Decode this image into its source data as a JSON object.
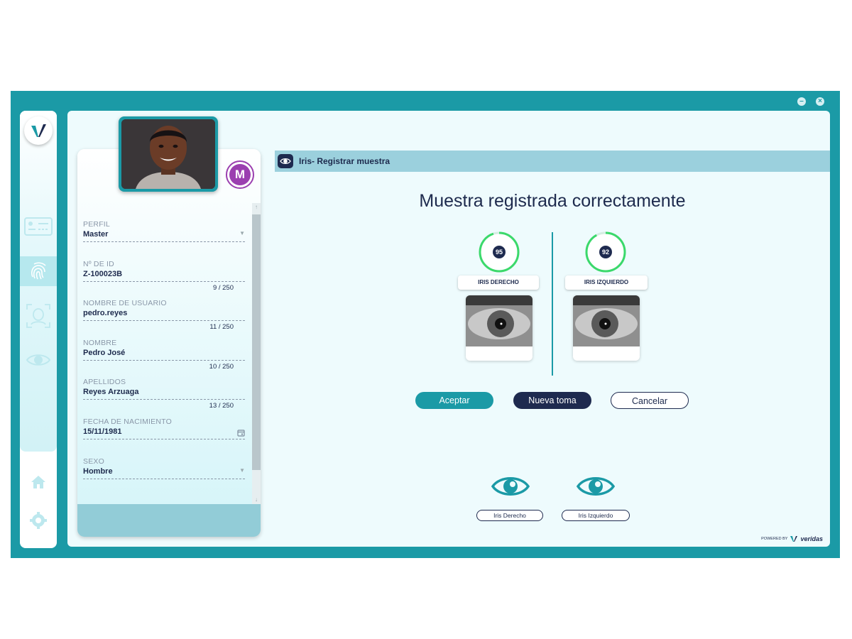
{
  "colors": {
    "primary": "#1b9aa6",
    "navy": "#1e2a4f",
    "badge": "#9b3fb0"
  },
  "sidebar": {
    "items": [
      {
        "name": "id-card-icon"
      },
      {
        "name": "fingerprint-icon",
        "active": true
      },
      {
        "name": "face-scan-icon"
      },
      {
        "name": "eye-icon"
      },
      {
        "name": "home-icon"
      },
      {
        "name": "gear-icon"
      }
    ]
  },
  "user": {
    "badge": "M",
    "fields": [
      {
        "label": "PERFIL",
        "value": "Master",
        "type": "select"
      },
      {
        "label": "Nº DE ID",
        "value": "Z-100023B",
        "count": "9 / 250"
      },
      {
        "label": "NOMBRE DE USUARIO",
        "value": "pedro.reyes",
        "count": "11 / 250"
      },
      {
        "label": "NOMBRE",
        "value": "Pedro José",
        "count": "10 / 250"
      },
      {
        "label": "APELLIDOS",
        "value": "Reyes Arzuaga",
        "count": "13 / 250"
      },
      {
        "label": "FECHA DE NACIMIENTO",
        "value": "15/11/1981",
        "type": "date"
      },
      {
        "label": "SEXO",
        "value": "Hombre",
        "type": "select"
      }
    ]
  },
  "section": {
    "title": "Iris- Registrar muestra"
  },
  "headline": "Muestra registrada correctamente",
  "iris": {
    "right": {
      "score": "95",
      "label": "IRIS DERECHO"
    },
    "left": {
      "score": "92",
      "label": "IRIS IZQUIERDO"
    }
  },
  "buttons": {
    "accept": "Aceptar",
    "new_take": "Nueva toma",
    "cancel": "Cancelar"
  },
  "eye_selectors": {
    "right": "Iris Derecho",
    "left": "Iris Izquierdo"
  },
  "footer": {
    "powered": "POWERED BY",
    "brand": "veridas"
  }
}
